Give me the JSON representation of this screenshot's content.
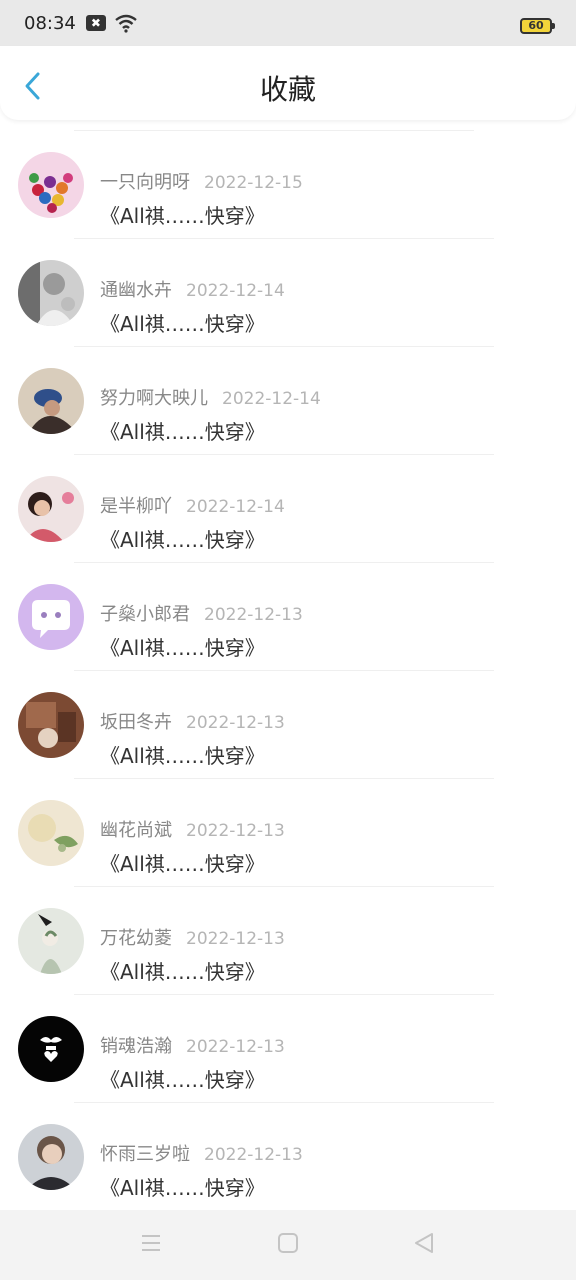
{
  "status_bar": {
    "time": "08:34",
    "battery": "60"
  },
  "header": {
    "title": "收藏"
  },
  "colors": {
    "accent": "#3aa7d8"
  },
  "items": [
    {
      "name": "一只向明呀",
      "date": "2022-12-15",
      "book": "《All祺……快穿》",
      "avatar": "candy-avatar"
    },
    {
      "name": "通幽水卉",
      "date": "2022-12-14",
      "book": "《All祺……快穿》",
      "avatar": "bw-portrait-avatar"
    },
    {
      "name": "努力啊大映儿",
      "date": "2022-12-14",
      "book": "《All祺……快穿》",
      "avatar": "cap-portrait-avatar"
    },
    {
      "name": "是半柳吖",
      "date": "2022-12-14",
      "book": "《All祺……快穿》",
      "avatar": "girl-avatar"
    },
    {
      "name": "子燊小郎君",
      "date": "2022-12-13",
      "book": "《All祺……快穿》",
      "avatar": "chat-bubble-avatar"
    },
    {
      "name": "坂田冬卉",
      "date": "2022-12-13",
      "book": "《All祺……快穿》",
      "avatar": "brown-photo-avatar"
    },
    {
      "name": "幽花尚斌",
      "date": "2022-12-13",
      "book": "《All祺……快穿》",
      "avatar": "flower-avatar"
    },
    {
      "name": "万花幼菱",
      "date": "2022-12-13",
      "book": "《All祺……快穿》",
      "avatar": "illustration-avatar"
    },
    {
      "name": "销魂浩瀚",
      "date": "2022-12-13",
      "book": "《All祺……快穿》",
      "avatar": "mustache-heart-avatar"
    },
    {
      "name": "怀雨三岁啦",
      "date": "2022-12-13",
      "book": "《All祺……快穿》",
      "avatar": "boy-portrait-avatar"
    }
  ]
}
